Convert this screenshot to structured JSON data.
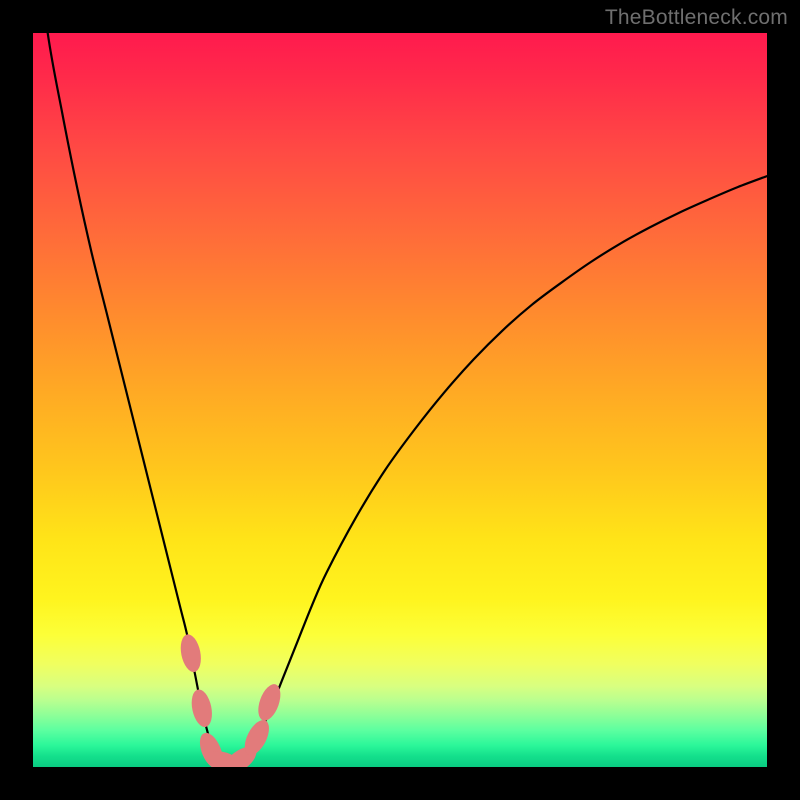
{
  "watermark": "TheBottleneck.com",
  "colors": {
    "curve_stroke": "#000000",
    "marker_fill": "#e27b7b",
    "marker_stroke": "#e27b7b"
  },
  "chart_data": {
    "type": "line",
    "title": "",
    "xlabel": "",
    "ylabel": "",
    "xlim": [
      0,
      100
    ],
    "ylim": [
      0,
      100
    ],
    "grid": false,
    "series": [
      {
        "name": "bottleneck-curve",
        "x": [
          0,
          2,
          4,
          6,
          8,
          10,
          12,
          14,
          16,
          18,
          20,
          21,
          22,
          23,
          24,
          25,
          26,
          27,
          28,
          29,
          30,
          32,
          34,
          36,
          38,
          40,
          44,
          48,
          52,
          56,
          60,
          64,
          68,
          72,
          76,
          80,
          84,
          88,
          92,
          96,
          100
        ],
        "y": [
          116,
          100,
          89,
          79,
          70,
          62,
          54,
          46,
          38,
          30,
          22,
          18,
          13,
          8,
          4,
          1.5,
          0.5,
          0.4,
          0.6,
          1.4,
          3,
          7,
          12,
          17,
          22,
          26.5,
          34,
          40.5,
          46,
          51,
          55.5,
          59.5,
          63,
          66,
          68.8,
          71.3,
          73.5,
          75.5,
          77.3,
          79,
          80.5
        ]
      }
    ],
    "markers": [
      {
        "x": 21.5,
        "y": 15.5
      },
      {
        "x": 23.0,
        "y": 8.0
      },
      {
        "x": 24.3,
        "y": 2.2
      },
      {
        "x": 26.0,
        "y": 0.7
      },
      {
        "x": 28.2,
        "y": 0.9
      },
      {
        "x": 30.5,
        "y": 4.0
      },
      {
        "x": 32.2,
        "y": 8.8
      }
    ],
    "marker_size": {
      "rx": 1.3,
      "ry": 2.6
    }
  }
}
